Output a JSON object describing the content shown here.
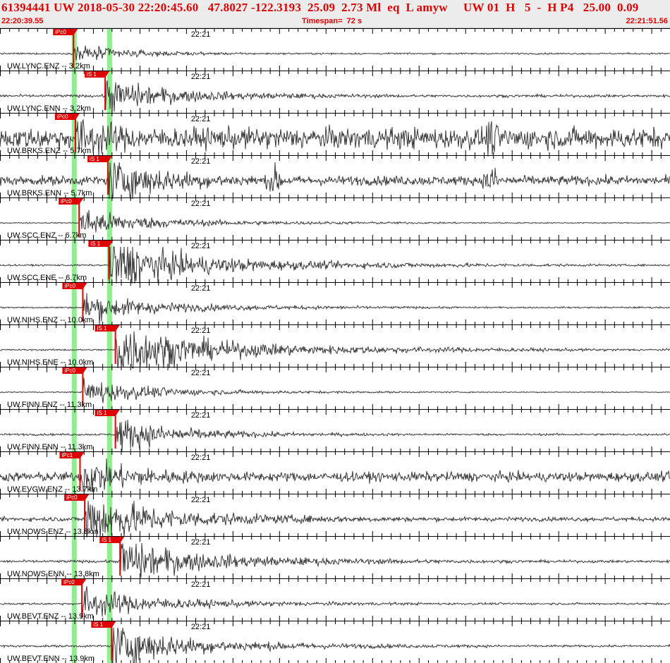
{
  "header": {
    "title": "61394441 UW 2018-05-30 22:20:45.60   47.8027 -122.3193  25.09  2.73 Ml  eq  L amyw     UW 01  H   5  -  H P4   25.00  0.09",
    "start_time": "22:20:39.55",
    "timespan": "Timespan=  72 s",
    "end_time": "22:21:51.56"
  },
  "colors": {
    "accent": "#e00000",
    "trace": "#3a3a3a",
    "pick": "#e00000",
    "pick_window": "#90ee90"
  },
  "chart_data": {
    "type": "line",
    "title": "61394441 UW 2018-05-30 22:20:45.60   47.8027 -122.3193  25.09  2.73 Ml  eq  L amyw     UW 01  H   5  -  H P4   25.00  0.09",
    "xlabel": "",
    "ylabel": "",
    "x_start": "22:20:39.55",
    "x_end": "22:21:51.56",
    "timespan_s": 72,
    "minute_mark": {
      "label": "22:21",
      "t": 20.45
    },
    "p_window_t": 7.9,
    "s_window_t": 11.7,
    "legend": "none",
    "traces": [
      {
        "label": "UW.LYNC.ENZ -- 3.2km",
        "pick": "iPc0",
        "pick_t": 7.9,
        "noise": 0.03,
        "amp": 0.35,
        "ring": 0.06,
        "bursts": []
      },
      {
        "label": "UW.LYNC.ENN -- 3.2km",
        "pick": "iS 1",
        "pick_t": 11.3,
        "noise": 0.05,
        "amp": 0.55,
        "ring": 0.2,
        "bursts": []
      },
      {
        "label": "UW.BRKS.ENZ -- 5.7km",
        "pick": "iPc0",
        "pick_t": 8.1,
        "noise": 0.4,
        "amp": 0.6,
        "ring": 0.35,
        "bursts": [
          [
            52.8,
            0.9
          ]
        ]
      },
      {
        "label": "UW.BRKS.ENN -- 5.7km",
        "pick": "iS 1",
        "pick_t": 11.6,
        "noise": 0.18,
        "amp": 0.7,
        "ring": 0.3,
        "bursts": [
          [
            29.5,
            0.7
          ],
          [
            52.8,
            0.7
          ]
        ]
      },
      {
        "label": "UW.SCC.ENZ -- 6.7km",
        "pick": "iPc0",
        "pick_t": 8.5,
        "noise": 0.02,
        "amp": 0.5,
        "ring": 0.15,
        "bursts": []
      },
      {
        "label": "UW.SCC.ENE -- 6.7km",
        "pick": "iS 1",
        "pick_t": 11.7,
        "noise": 0.03,
        "amp": 0.95,
        "ring": 0.35,
        "bursts": []
      },
      {
        "label": "UW.NIHS.ENZ -- 10.0km",
        "pick": "iPc0",
        "pick_t": 8.9,
        "noise": 0.03,
        "amp": 0.45,
        "ring": 0.18,
        "bursts": []
      },
      {
        "label": "UW.NIHS.ENE -- 10.0km",
        "pick": "iS 1",
        "pick_t": 12.4,
        "noise": 0.03,
        "amp": 0.9,
        "ring": 0.4,
        "bursts": []
      },
      {
        "label": "UW.FINN.ENZ -- 11.3km",
        "pick": "iPc0",
        "pick_t": 8.9,
        "noise": 0.02,
        "amp": 0.5,
        "ring": 0.12,
        "bursts": []
      },
      {
        "label": "UW.FINN.ENN -- 11.3km",
        "pick": "iS 1",
        "pick_t": 12.4,
        "noise": 0.04,
        "amp": 0.6,
        "ring": 0.15,
        "bursts": []
      },
      {
        "label": "UW.EVGW.ENZ -- 13.7km",
        "pick": "iPc1",
        "pick_t": 8.6,
        "noise": 0.18,
        "amp": 0.5,
        "ring": 0.3,
        "bursts": []
      },
      {
        "label": "UW.NOWS.ENZ -- 13.8km",
        "pick": "iPc0",
        "pick_t": 9.1,
        "noise": 0.08,
        "amp": 0.95,
        "ring": 0.35,
        "bursts": []
      },
      {
        "label": "UW.NOWS.ENN -- 13.8km",
        "pick": "iS 1",
        "pick_t": 12.9,
        "noise": 0.05,
        "amp": 0.7,
        "ring": 0.3,
        "bursts": []
      },
      {
        "label": "UW.BEVT.ENZ -- 13.9km",
        "pick": "iPc0",
        "pick_t": 8.8,
        "noise": 0.04,
        "amp": 0.5,
        "ring": 0.2,
        "bursts": []
      },
      {
        "label": "UW.BEVT.ENN -- 13.9km",
        "pick": "iS 1",
        "pick_t": 12.0,
        "noise": 0.04,
        "amp": 0.8,
        "ring": 0.25,
        "bursts": []
      }
    ]
  }
}
